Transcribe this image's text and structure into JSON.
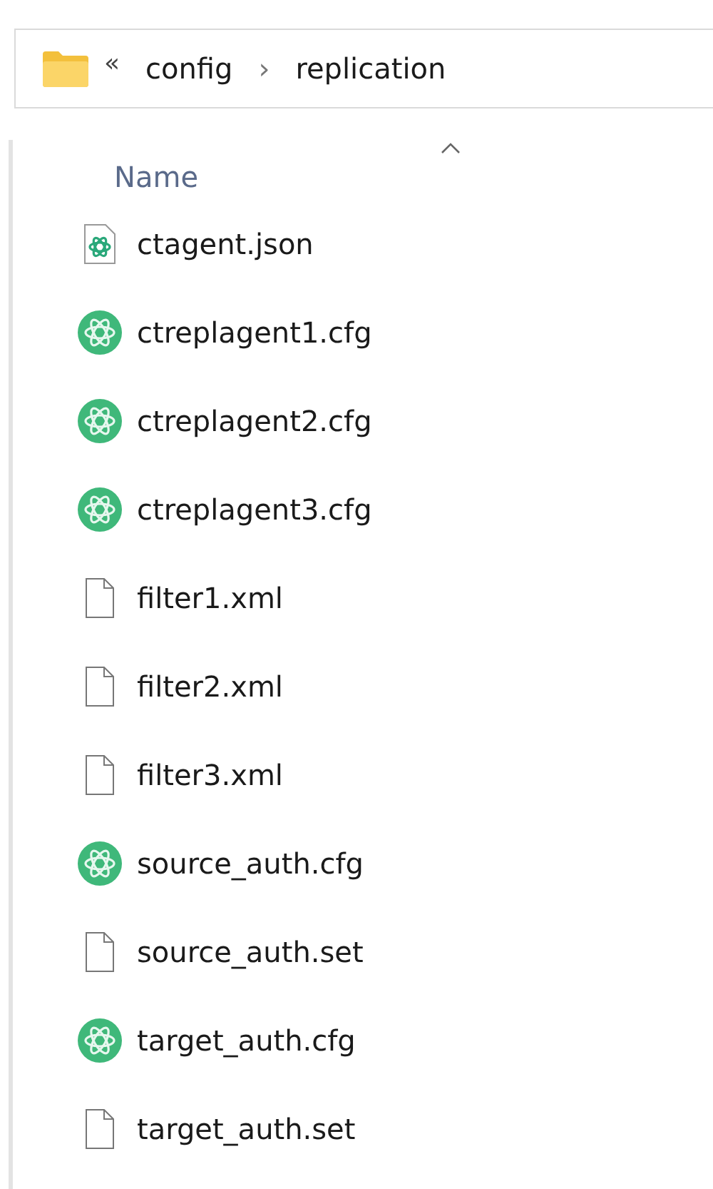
{
  "address_bar": {
    "overflow": "«",
    "path": [
      "config",
      "replication"
    ],
    "separator": "›"
  },
  "column_header": {
    "label": "Name",
    "sort_ascending": true
  },
  "files": [
    {
      "name": "ctagent.json",
      "kind": "atom-doc"
    },
    {
      "name": "ctreplagent1.cfg",
      "kind": "atom"
    },
    {
      "name": "ctreplagent2.cfg",
      "kind": "atom"
    },
    {
      "name": "ctreplagent3.cfg",
      "kind": "atom"
    },
    {
      "name": "filter1.xml",
      "kind": "blank"
    },
    {
      "name": "filter2.xml",
      "kind": "blank"
    },
    {
      "name": "filter3.xml",
      "kind": "blank"
    },
    {
      "name": "source_auth.cfg",
      "kind": "atom"
    },
    {
      "name": "source_auth.set",
      "kind": "blank"
    },
    {
      "name": "target_auth.cfg",
      "kind": "atom"
    },
    {
      "name": "target_auth.set",
      "kind": "blank"
    }
  ]
}
